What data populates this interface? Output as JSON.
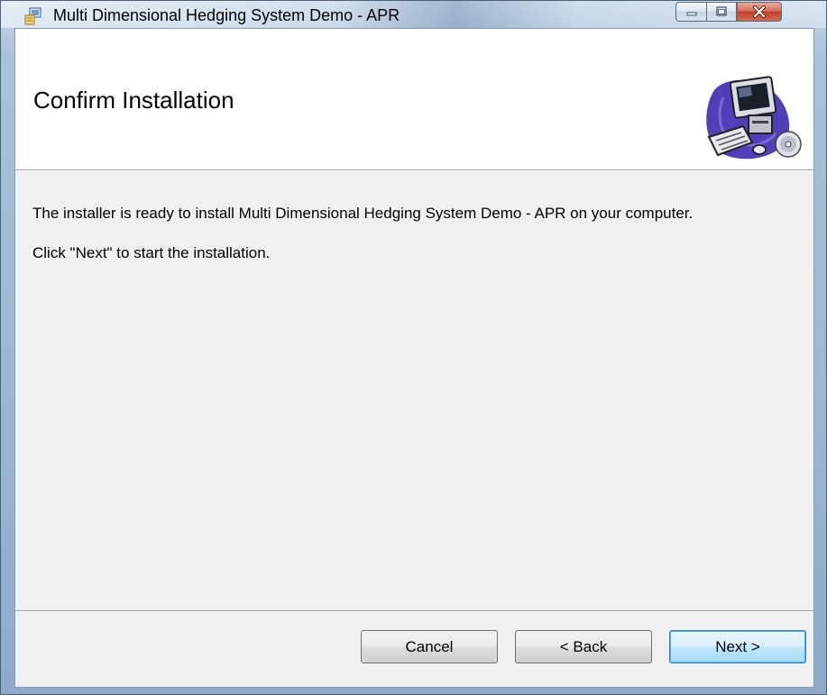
{
  "window": {
    "title": "Multi Dimensional Hedging System Demo - APR",
    "minimize_icon": "minimize-icon",
    "maximize_icon": "maximize-icon",
    "close_icon": "close-icon",
    "app_icon": "installer-icon"
  },
  "banner": {
    "title": "Confirm Installation",
    "art_icon": "computer-cd-illustration"
  },
  "body": {
    "line1": "The installer is ready to install Multi Dimensional Hedging System Demo - APR on your computer.",
    "line2": "Click \"Next\" to start the installation."
  },
  "buttons": {
    "cancel": "Cancel",
    "back": "< Back",
    "next": "Next >"
  },
  "colors": {
    "client_bg": "#f0f0f0",
    "banner_bg": "#ffffff",
    "close_red": "#c2402a",
    "default_button_blue": "#48b0e8"
  }
}
